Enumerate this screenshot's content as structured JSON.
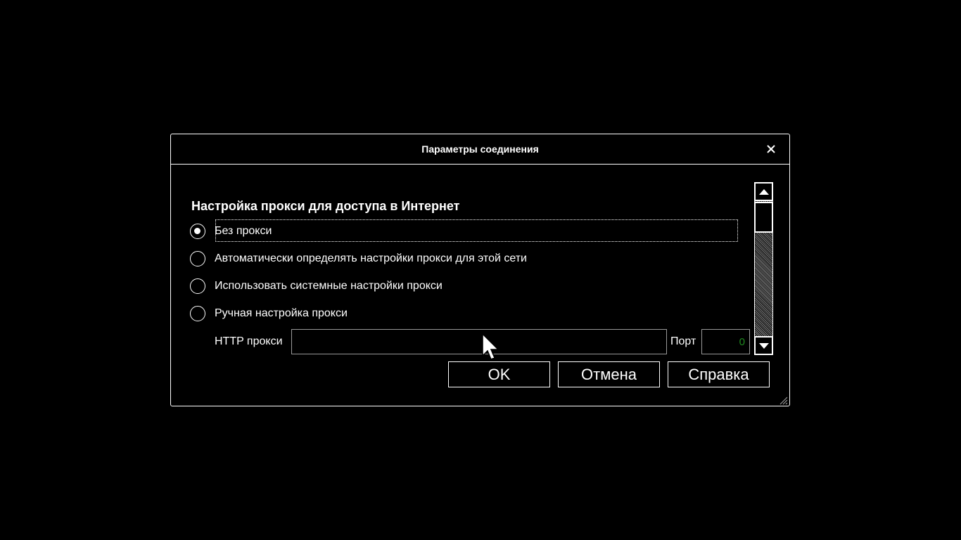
{
  "dialog": {
    "title": "Параметры соединения",
    "close_icon": "close-icon"
  },
  "proxy": {
    "heading": "Настройка прокси для доступа в Интернет",
    "options": [
      {
        "label": "Без прокси",
        "checked": true
      },
      {
        "label": "Автоматически определять настройки прокси для этой сети",
        "checked": false
      },
      {
        "label": "Использовать системные настройки прокси",
        "checked": false
      },
      {
        "label": "Ручная настройка прокси",
        "checked": false
      }
    ],
    "http_label": "HTTP прокси",
    "http_value": "",
    "port_label": "Порт",
    "port_value": "0"
  },
  "buttons": {
    "ok": "OK",
    "cancel": "Отмена",
    "help": "Справка"
  },
  "colors": {
    "background": "#000000",
    "foreground": "#ffffff",
    "port_text": "#1f8a1f"
  }
}
